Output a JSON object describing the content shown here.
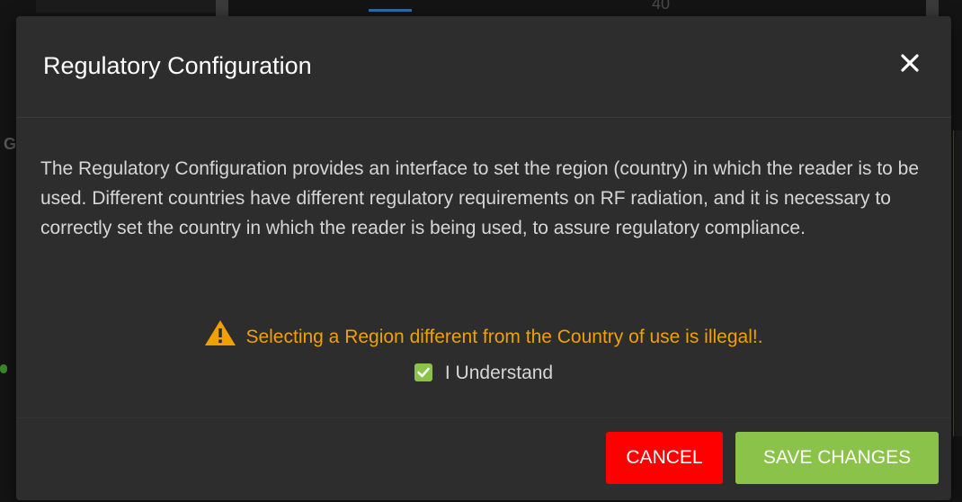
{
  "background": {
    "partial_value": "40",
    "letter_left": "G"
  },
  "modal": {
    "title": "Regulatory Configuration",
    "close_icon": "close-icon",
    "description": "The Regulatory Configuration provides an interface to set the region (country) in which the reader is to be used. Different countries have different regulatory requirements on RF radiation, and it is necessary to correctly set the country in which the reader is being used, to assure regulatory compliance.",
    "warning": {
      "icon": "warning-triangle-icon",
      "text": "Selecting a Region different from the Country of use is illegal!."
    },
    "acknowledge": {
      "checked": true,
      "label": "I Understand"
    },
    "buttons": {
      "cancel_label": "CANCEL",
      "save_label": "SAVE CHANGES"
    }
  },
  "colors": {
    "modal_bg": "#2d2d2d",
    "warning": "#f0a000",
    "cancel": "#ff0000",
    "save": "#8bc34a",
    "checkbox": "#8bc34a"
  }
}
